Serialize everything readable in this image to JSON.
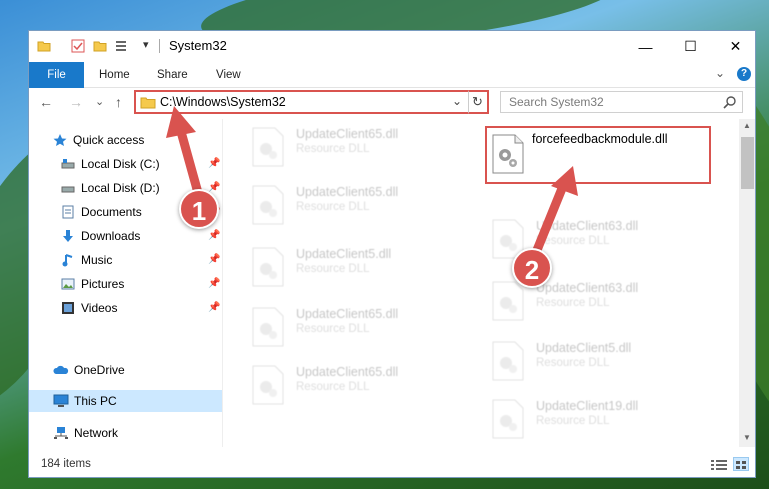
{
  "window": {
    "title": "System32",
    "quick_access_arrow": "▾",
    "buttons": {
      "minimize": "—",
      "maximize": "☐",
      "close": "✕"
    }
  },
  "ribbon": {
    "tabs": [
      "File",
      "Home",
      "Share",
      "View"
    ],
    "expand": "⌄",
    "help": "?"
  },
  "nav": {
    "back": "←",
    "forward": "→",
    "recent": "⌄",
    "up": "↑",
    "address": "C:\\Windows\\System32",
    "address_dropdown": "⌄",
    "refresh": "↻",
    "search_placeholder": "Search System32"
  },
  "sidebar": {
    "items": [
      {
        "label": "Quick access",
        "icon": "star-icon"
      },
      {
        "label": "Local Disk (C:)",
        "icon": "drive-icon",
        "pinned": true
      },
      {
        "label": "Local Disk (D:)",
        "icon": "drive-icon",
        "pinned": true
      },
      {
        "label": "Documents",
        "icon": "documents-icon",
        "pinned": true
      },
      {
        "label": "Downloads",
        "icon": "downloads-icon",
        "pinned": true
      },
      {
        "label": "Music",
        "icon": "music-icon",
        "pinned": true
      },
      {
        "label": "Pictures",
        "icon": "pictures-icon",
        "pinned": true
      },
      {
        "label": "Videos",
        "icon": "videos-icon",
        "pinned": true
      },
      {
        "label": "OneDrive",
        "icon": "cloud-icon"
      },
      {
        "label": "This PC",
        "icon": "computer-icon",
        "selected": true
      },
      {
        "label": "Network",
        "icon": "network-icon"
      }
    ],
    "pin_glyph": "📌"
  },
  "files": {
    "highlighted": {
      "name": "forcefeedbackmodule.dll"
    },
    "left_column": [
      {
        "name": "UpdateClient65.dll",
        "type": "Resource DLL"
      },
      {
        "name": "UpdateClient65.dll",
        "type": "Resource DLL"
      },
      {
        "name": "UpdateClient5.dll",
        "type": "Resource DLL"
      },
      {
        "name": "UpdateClient65.dll",
        "type": "Resource DLL"
      },
      {
        "name": "UpdateClient65.dll",
        "type": "Resource DLL"
      }
    ],
    "right_column": [
      {
        "name": "UpdateClient63.dll",
        "type": "Resource DLL"
      },
      {
        "name": "UpdateClient63.dll",
        "type": "Resource DLL"
      },
      {
        "name": "UpdateClient5.dll",
        "type": "Resource DLL"
      },
      {
        "name": "UpdateClient19.dll",
        "type": "Resource DLL"
      }
    ]
  },
  "status": {
    "count": "184 items"
  },
  "annotations": {
    "step1": "1",
    "step2": "2"
  },
  "colors": {
    "accent": "#1979ca",
    "highlight": "#d9534f",
    "selected": "#cce8ff"
  }
}
